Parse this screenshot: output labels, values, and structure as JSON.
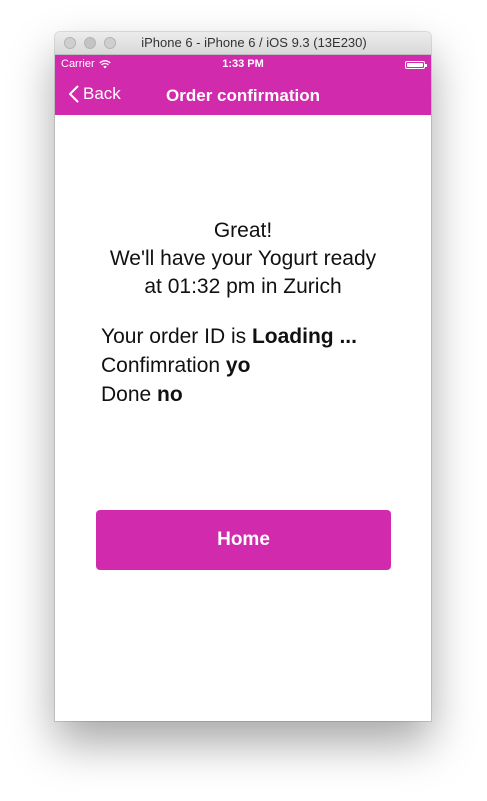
{
  "window": {
    "title": "iPhone 6 - iPhone 6 / iOS 9.3 (13E230)"
  },
  "status_bar": {
    "carrier": "Carrier",
    "time": "1:33 PM",
    "wifi_icon": "wifi-icon",
    "battery_icon": "battery-icon"
  },
  "nav_bar": {
    "back_label": "Back",
    "back_icon": "chevron-left-icon",
    "title": "Order confirmation"
  },
  "confirmation": {
    "line1": "Great!",
    "line2": "We'll have your Yogurt ready",
    "line3": "at 01:32 pm in Zurich",
    "order_id_label": "Your order ID is ",
    "order_id_value": "Loading ...",
    "confirmation_label": "Confimration ",
    "confirmation_value": "yo",
    "done_label": "Done ",
    "done_value": "no"
  },
  "home_button": {
    "label": "Home"
  },
  "colors": {
    "accent": "#d22aad",
    "background": "#ffffff",
    "text": "#111111"
  }
}
